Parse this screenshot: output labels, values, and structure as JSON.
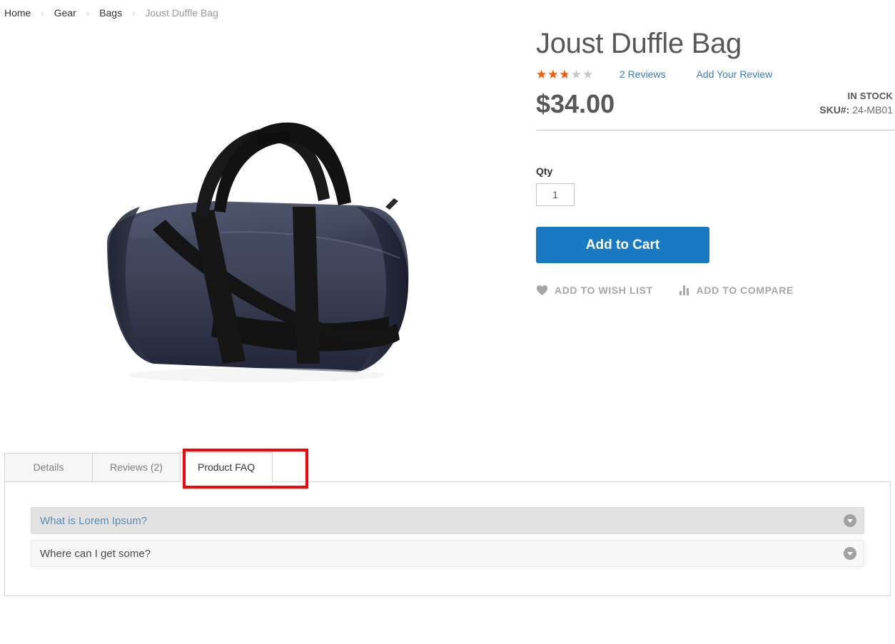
{
  "breadcrumb": {
    "separator": "›",
    "items": [
      {
        "label": "Home",
        "current": false
      },
      {
        "label": "Gear",
        "current": false
      },
      {
        "label": "Bags",
        "current": false
      },
      {
        "label": "Joust Duffle Bag",
        "current": true
      }
    ]
  },
  "product": {
    "title": "Joust Duffle Bag",
    "rating_percent": 50,
    "stars_glyphs": "★★★★★",
    "reviews_link": "2 Reviews",
    "add_review_link": "Add Your Review",
    "price": "$34.00",
    "stock_status": "IN STOCK",
    "sku_label": "SKU#:",
    "sku_value": "24-MB01",
    "image_alt": "Navy blue duffle bag with black straps"
  },
  "purchase": {
    "qty_label": "Qty",
    "qty_value": "1",
    "qty_placeholder": "1",
    "add_to_cart_label": "Add to Cart",
    "wishlist_label": "ADD TO WISH LIST",
    "compare_label": "ADD TO COMPARE",
    "wishlist_icon": "heart-icon",
    "compare_icon": "bar-chart-icon"
  },
  "tabs": [
    {
      "label": "Details",
      "active": false
    },
    {
      "label": "Reviews (2)",
      "active": false
    },
    {
      "label": "Product FAQ",
      "active": true
    }
  ],
  "faq": {
    "items": [
      {
        "question": "What is Lorem Ipsum?",
        "state": "state-open",
        "toggle_icon": "chevron-down-icon"
      },
      {
        "question": "Where can I get some?",
        "state": "state-closed",
        "toggle_icon": "chevron-down-icon"
      }
    ]
  },
  "colors": {
    "accent_blue": "#1979c3",
    "link_blue": "#3b7cb5",
    "star_orange": "#ff5501",
    "annotation_red": "#fb0007",
    "bag_navy": "#3f4459",
    "bag_black": "#181818"
  }
}
